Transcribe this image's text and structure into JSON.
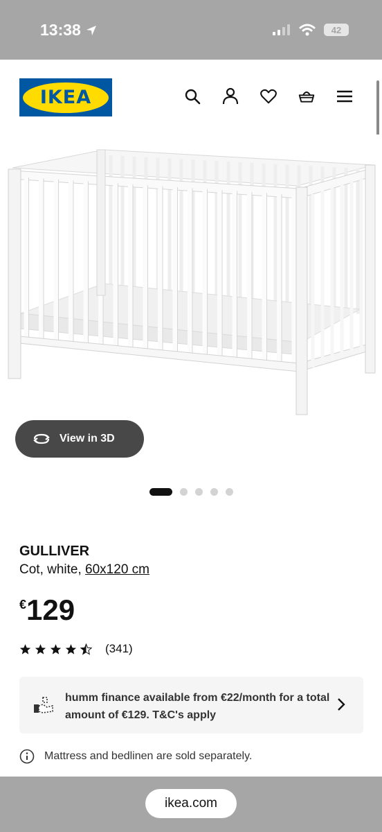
{
  "status": {
    "time": "13:38",
    "battery": "42"
  },
  "header": {
    "logo_text": "IKEA",
    "brand_colors": {
      "blue": "#0058a3",
      "yellow": "#ffdb00"
    },
    "icons": [
      "search-icon",
      "account-icon",
      "heart-icon",
      "basket-icon",
      "menu-icon"
    ]
  },
  "gallery": {
    "view3d_label": "View in 3D",
    "image_count": 5,
    "active_index": 0
  },
  "product": {
    "name": "GULLIVER",
    "description": "Cot, white, ",
    "size": "60x120 cm",
    "currency": "€",
    "price": "129",
    "rating_value": 4.5,
    "rating_max": 5,
    "rating_count": "(341)"
  },
  "finance": {
    "text": "humm finance available from €22/month for a total amount of €129. T&C's apply"
  },
  "notice": {
    "text": "Mattress and bedlinen are sold separately."
  },
  "browser": {
    "url": "ikea.com"
  }
}
